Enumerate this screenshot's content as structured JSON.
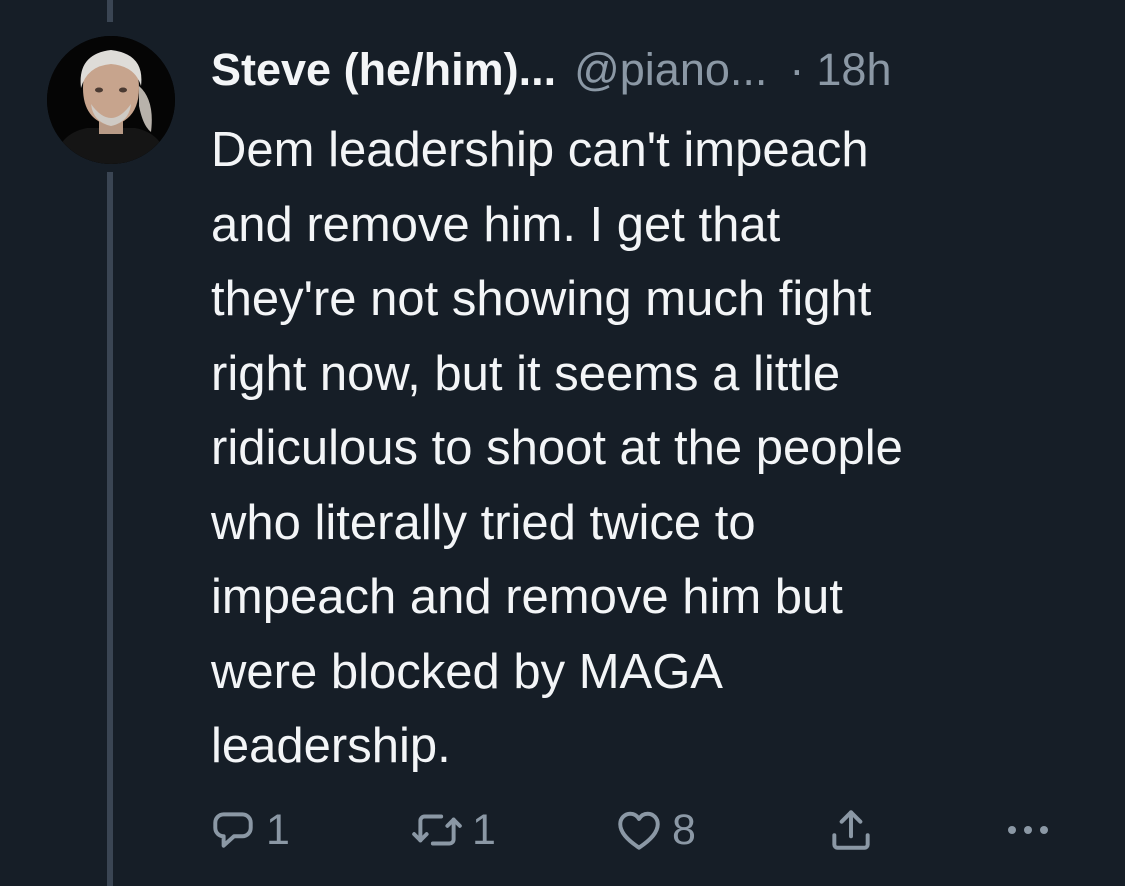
{
  "tweet": {
    "author": {
      "display_name": "Steve (he/him)...",
      "handle": "@piano...",
      "separator": "·",
      "time": "18h"
    },
    "body_lines": [
      "Dem leadership can't impeach",
      "and remove him. I get that",
      "they're not showing much fight",
      "right now, but it seems a little",
      "ridiculous to shoot at the people",
      "who literally tried twice to",
      "impeach and remove him but",
      "were blocked by MAGA",
      "leadership."
    ],
    "actions": {
      "reply_count": "1",
      "retweet_count": "1",
      "like_count": "8"
    }
  },
  "icons": {
    "reply": "comment-icon",
    "retweet": "retweet-icon",
    "like": "heart-icon",
    "share": "share-icon",
    "more": "more-icon"
  },
  "colors": {
    "background": "#161e27",
    "primary_text": "#f3f5f7",
    "secondary_text": "#8b98a5",
    "thread_line": "#3a4553"
  }
}
